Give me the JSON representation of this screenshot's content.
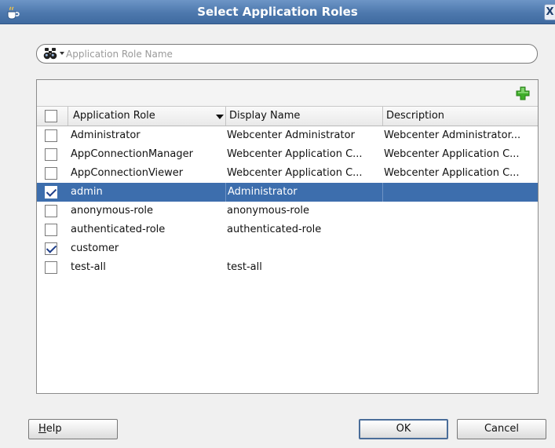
{
  "window": {
    "title": "Select Application Roles",
    "close_glyph": "X"
  },
  "search": {
    "placeholder": "Application Role Name",
    "value": ""
  },
  "table": {
    "columns": [
      "Application Role",
      "Display Name",
      "Description"
    ],
    "rows": [
      {
        "checked": false,
        "selected": false,
        "role": "Administrator",
        "display": "Webcenter Administrator",
        "description": "Webcenter Administrator..."
      },
      {
        "checked": false,
        "selected": false,
        "role": "AppConnectionManager",
        "display": "Webcenter Application C...",
        "description": "Webcenter Application C..."
      },
      {
        "checked": false,
        "selected": false,
        "role": "AppConnectionViewer",
        "display": "Webcenter Application C...",
        "description": "Webcenter Application C..."
      },
      {
        "checked": true,
        "selected": true,
        "role": "admin",
        "display": "Administrator",
        "description": ""
      },
      {
        "checked": false,
        "selected": false,
        "role": "anonymous-role",
        "display": "anonymous-role",
        "description": ""
      },
      {
        "checked": false,
        "selected": false,
        "role": "authenticated-role",
        "display": "authenticated-role",
        "description": ""
      },
      {
        "checked": true,
        "selected": false,
        "role": "customer",
        "display": "",
        "description": ""
      },
      {
        "checked": false,
        "selected": false,
        "role": "test-all",
        "display": "test-all",
        "description": ""
      }
    ]
  },
  "buttons": {
    "help_mnemonic": "H",
    "help_rest": "elp",
    "ok": "OK",
    "cancel": "Cancel"
  },
  "icons": {
    "app": "coffee-cup-icon",
    "search": "binoculars-icon",
    "add": "green-plus-icon"
  },
  "colors": {
    "title_bar": "#4d78ad",
    "selection": "#3d6ead",
    "add_icon": "#3fae2a"
  }
}
